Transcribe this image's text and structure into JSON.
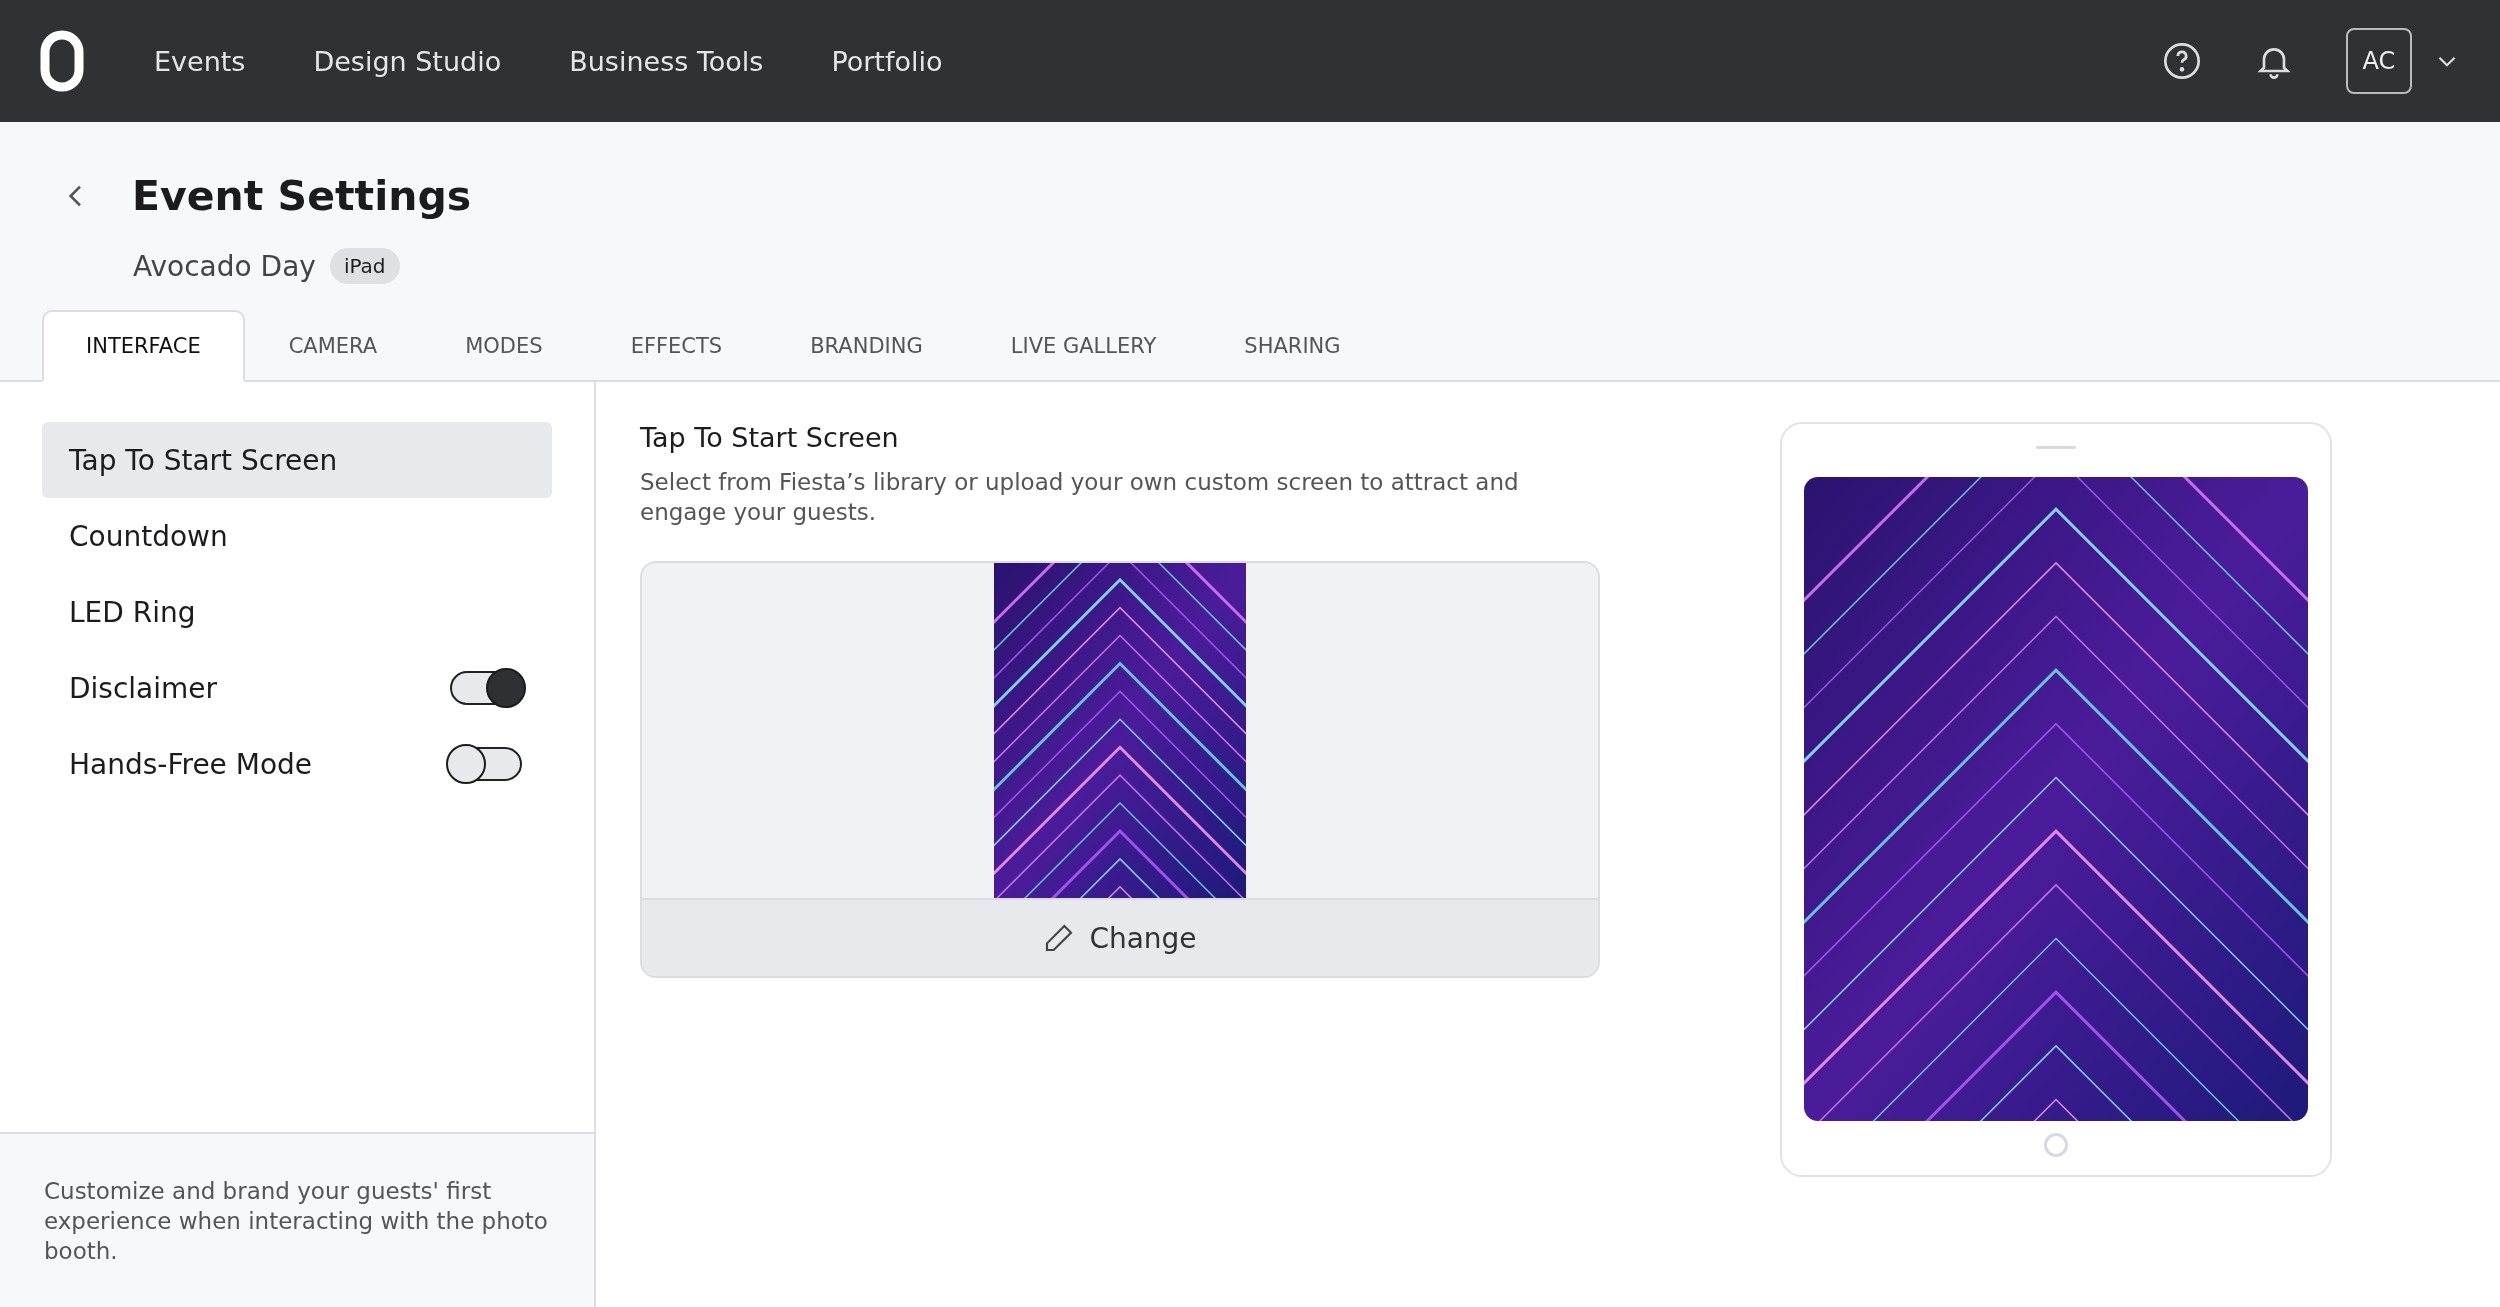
{
  "nav": {
    "items": [
      {
        "label": "Events"
      },
      {
        "label": "Design Studio"
      },
      {
        "label": "Business Tools"
      },
      {
        "label": "Portfolio"
      }
    ],
    "avatar": "AC"
  },
  "header": {
    "title": "Event Settings",
    "event_name": "Avocado Day",
    "device_badge": "iPad"
  },
  "tabs": [
    {
      "label": "INTERFACE",
      "selected": true
    },
    {
      "label": "CAMERA",
      "selected": false
    },
    {
      "label": "MODES",
      "selected": false
    },
    {
      "label": "EFFECTS",
      "selected": false
    },
    {
      "label": "BRANDING",
      "selected": false
    },
    {
      "label": "LIVE GALLERY",
      "selected": false
    },
    {
      "label": "SHARING",
      "selected": false
    }
  ],
  "sidebar": {
    "items": [
      {
        "label": "Tap To Start Screen",
        "kind": "link",
        "selected": true
      },
      {
        "label": "Countdown",
        "kind": "link",
        "selected": false
      },
      {
        "label": "LED Ring",
        "kind": "link",
        "selected": false
      },
      {
        "label": "Disclaimer",
        "kind": "toggle",
        "selected": false,
        "on": true
      },
      {
        "label": "Hands-Free Mode",
        "kind": "toggle",
        "selected": false,
        "on": false
      }
    ],
    "footer": "Customize and brand your guests' first experience when interacting with the photo booth."
  },
  "section": {
    "title": "Tap To Start Screen",
    "description": "Select from Fiesta’s library or upload your own custom screen to attract and engage your guests.",
    "change_button": "Change"
  }
}
